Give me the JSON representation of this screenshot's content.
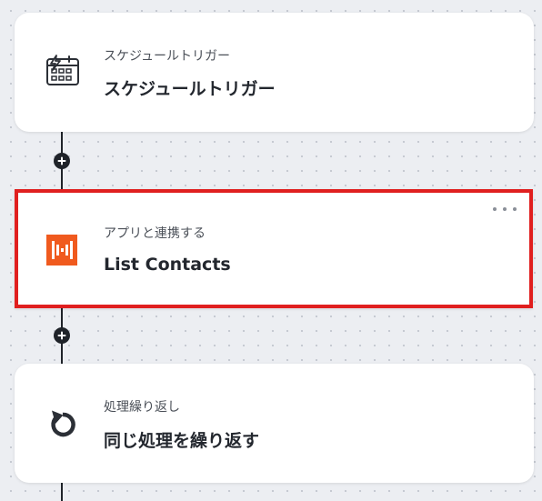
{
  "steps": [
    {
      "subtitle": "スケジュールトリガー",
      "title": "スケジュールトリガー",
      "icon": "schedule-trigger-icon"
    },
    {
      "subtitle": "アプリと連携する",
      "title": "List Contacts",
      "icon": "app-logo-icon",
      "selected": true,
      "icon_color": "#f05a1e"
    },
    {
      "subtitle": "処理繰り返し",
      "title": "同じ処理を繰り返す",
      "icon": "loop-icon"
    }
  ],
  "colors": {
    "selection_border": "#e01f1f",
    "connector": "#1f2329",
    "background": "#eceef2"
  }
}
